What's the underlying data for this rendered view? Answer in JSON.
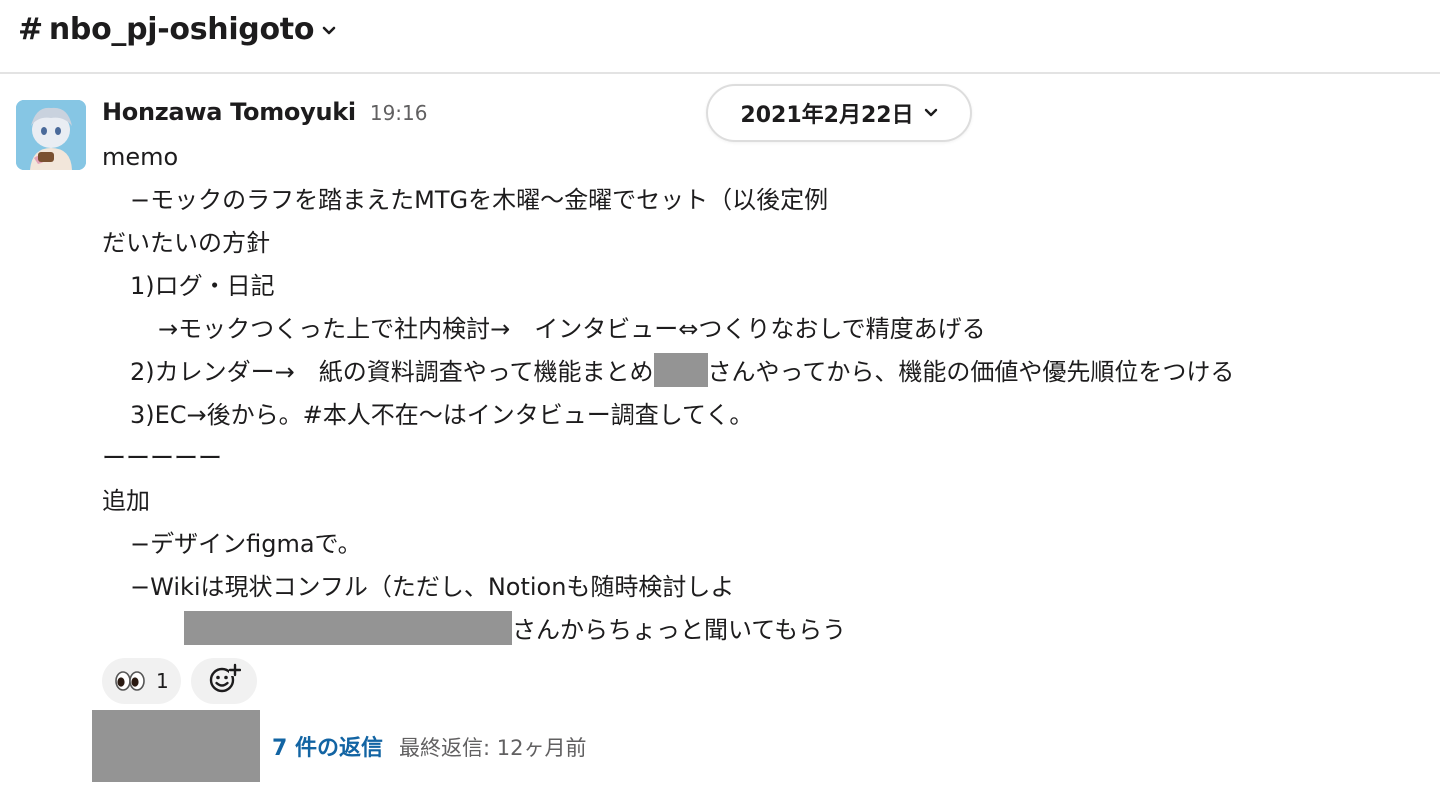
{
  "channel": {
    "hash": "#",
    "name": "nbo_pj-oshigoto",
    "chevron_icon": "chevron-down-icon"
  },
  "date_divider": {
    "label": "2021年2月22日"
  },
  "message": {
    "author": "Honzawa Tomoyuki",
    "time": "19:16",
    "lines": {
      "l0": "memo",
      "l1": "−モックのラフを踏まえたMTGを木曜〜金曜でセット（以後定例",
      "l2": "だいたいの方針",
      "l3": "1)ログ・日記",
      "l4": "→モックつくった上で社内検討→　インタビュー⇔つくりなおしで精度あげる",
      "l5a": "2)カレンダー→　紙の資料調査やって機能まとめ",
      "l5b": "さんやってから、機能の価値や優先順位をつける",
      "l6": "3)EC→後から。#本人不在〜はインタビュー調査してく。",
      "l7": "ーーーーー",
      "l8": "追加",
      "l9": "−デザインfigmaで。",
      "l10": "−Wikiは現状コンフル（ただし、Notionも随時検討しよ",
      "l11": "さんからちょっと聞いてもらう"
    }
  },
  "reactions": [
    {
      "emoji": "eyes-icon",
      "count": "1"
    }
  ],
  "add_reaction_icon": "add-reaction-icon",
  "thread": {
    "reply_count": "7 件の返信",
    "last_reply": "最終返信: 12ヶ月前"
  },
  "colors": {
    "link": "#1264a3",
    "muted": "#616061",
    "redaction": "#949494",
    "reaction_bg": "#f1f1f1"
  }
}
